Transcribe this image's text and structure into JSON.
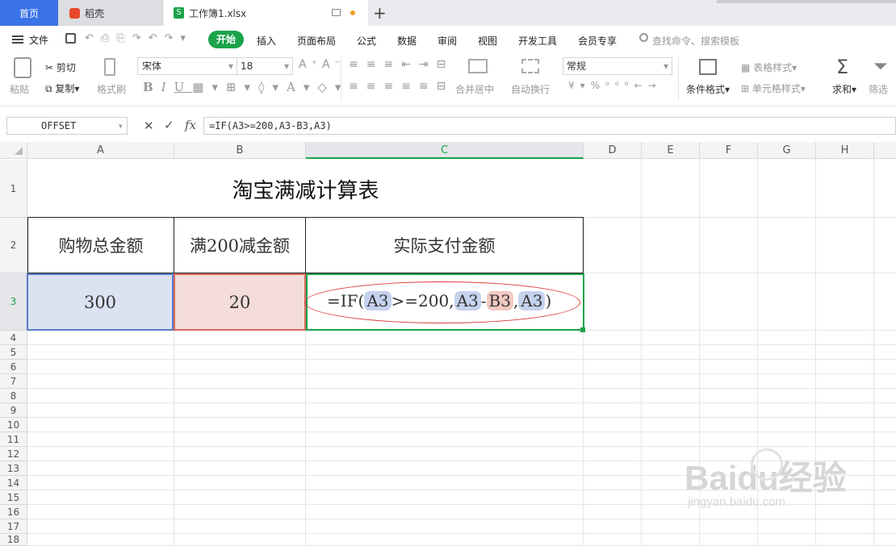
{
  "tabs": {
    "home": "首页",
    "daoke": "稻壳",
    "workbook": "工作簿1.xlsx"
  },
  "menu": {
    "file": "文件",
    "start": "开始",
    "insert": "插入",
    "layout": "页面布局",
    "formula": "公式",
    "data": "数据",
    "review": "审阅",
    "view": "视图",
    "dev": "开发工具",
    "member": "会员专享",
    "search_placeholder": "查找命令、搜索模板"
  },
  "ribbon": {
    "paste": "粘贴",
    "cut": "剪切",
    "copy": "复制",
    "format_painter": "格式刷",
    "font_name": "宋体",
    "font_size": "18",
    "merge": "合并居中",
    "wrap": "自动换行",
    "number_format": "常规",
    "cond_format": "条件格式",
    "table_style": "表格样式",
    "cell_style": "单元格样式",
    "sum": "求和",
    "filter": "筛选"
  },
  "formula_bar": {
    "name_box": "OFFSET",
    "fx": "fx",
    "formula": "=IF(A3>=200,A3-B3,A3)"
  },
  "columns": [
    "A",
    "B",
    "C",
    "D",
    "E",
    "F",
    "G",
    "H"
  ],
  "rows": [
    "1",
    "2",
    "3",
    "4",
    "5",
    "6",
    "7",
    "8",
    "9",
    "10",
    "11",
    "12",
    "13",
    "14",
    "15",
    "16",
    "17",
    "18"
  ],
  "sheet": {
    "title": "淘宝满减计算表",
    "headers": [
      "购物总金额",
      "满200减金额",
      "实际支付金额"
    ],
    "values": [
      "300",
      "20"
    ],
    "formula_parts": {
      "p1": "=IF(",
      "r1": "A3",
      "p2": ">=200,",
      "r2": "A3",
      "p3": "-",
      "r3": "B3",
      "p4": ",",
      "r4": "A3",
      "p5": ")"
    }
  },
  "watermark": {
    "brand": "Bai",
    "suffix": "du经验",
    "url": "jingyan.baidu.com"
  },
  "colors": {
    "accent": "#1aa34a",
    "tab_home": "#3b73e8",
    "ref_blue": "#c5d2ee",
    "ref_red": "#f3c9c3"
  }
}
